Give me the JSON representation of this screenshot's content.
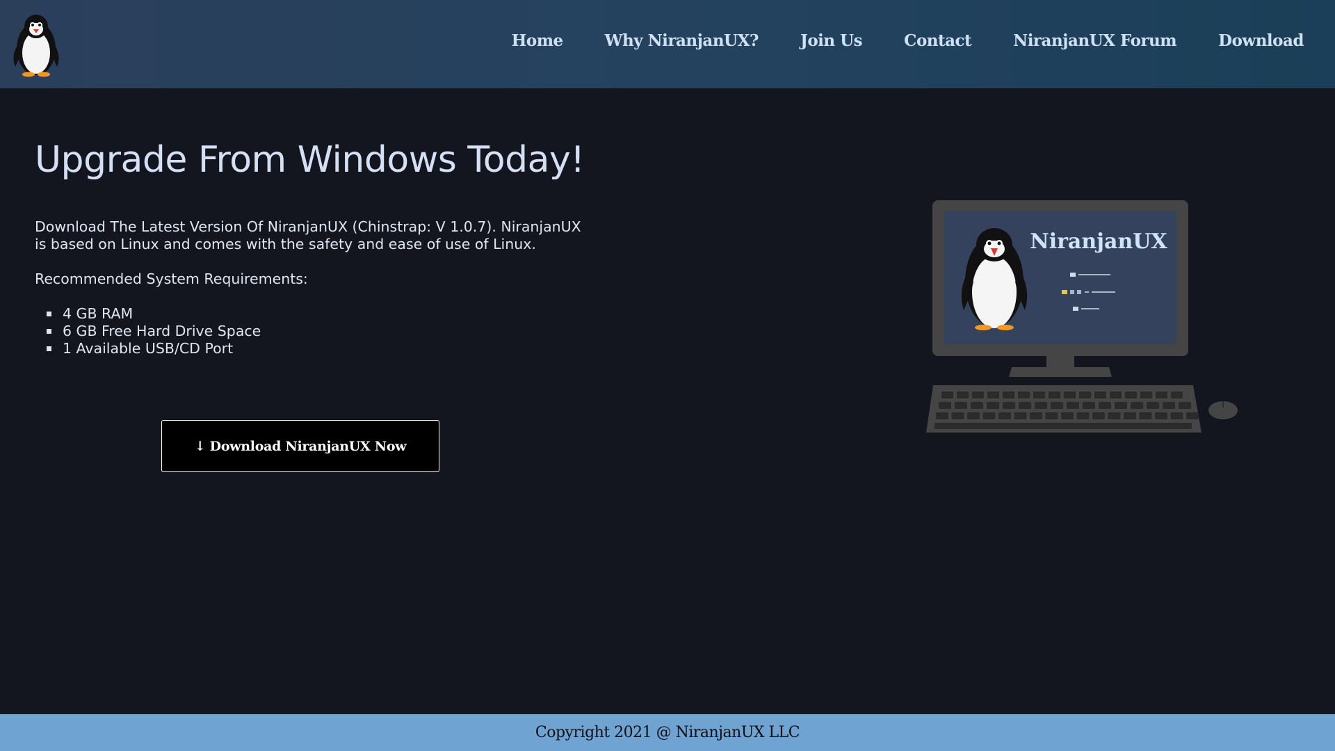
{
  "header": {
    "logo_icon": "penguin-icon",
    "nav": [
      {
        "label": "Home"
      },
      {
        "label": "Why NiranjanUX?"
      },
      {
        "label": "Join Us"
      },
      {
        "label": "Contact"
      },
      {
        "label": "NiranjanUX Forum"
      },
      {
        "label": "Download"
      }
    ]
  },
  "main": {
    "title": "Upgrade From Windows Today!",
    "intro": "Download The Latest Version Of NiranjanUX (Chinstrap: V 1.0.7). NiranjanUX is based on Linux and comes with the safety and ease of use of Linux.",
    "requirements_heading": "Recommended System Requirements:",
    "requirements": [
      "4 GB RAM",
      "6 GB Free Hard Drive Space",
      "1 Available USB/CD Port"
    ],
    "download_button": "↓ Download NiranjanUX Now"
  },
  "illustration": {
    "screen_title": "NiranjanUX",
    "icons": [
      "penguin-icon",
      "computer-icon",
      "keyboard-icon",
      "mouse-icon"
    ]
  },
  "footer": {
    "copyright": "Copyright 2021 @ NiranjanUX LLC"
  },
  "colors": {
    "nav_bg": "#24425e",
    "page_bg": "#13161f",
    "footer_bg": "#6fa3d2",
    "button_bg": "#000000"
  }
}
